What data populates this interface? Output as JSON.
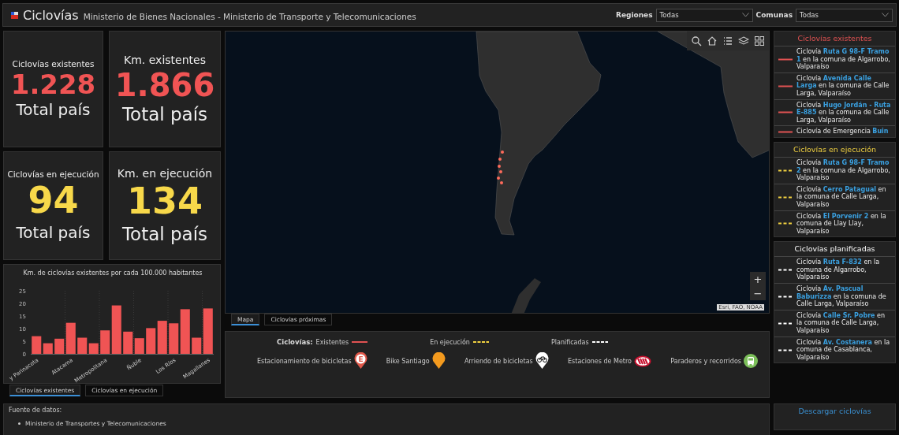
{
  "header": {
    "title": "Ciclovías",
    "subtitle": "Ministerio de Bienes Nacionales - Ministerio de Transporte y Telecomunicaciones",
    "filters": [
      {
        "label": "Regiones",
        "value": "Todas"
      },
      {
        "label": "Comunas",
        "value": "Todas"
      }
    ]
  },
  "stats": [
    {
      "label": "Ciclovías existentes",
      "value": "1.228",
      "caption": "Total país",
      "color": "#f05454"
    },
    {
      "label": "Km. existentes",
      "value": "1.866",
      "caption": "Total país",
      "color": "#f05454"
    },
    {
      "label": "Ciclovías en ejecución",
      "value": "94",
      "caption": "Total país",
      "color": "#f7d84a"
    },
    {
      "label": "Km. en ejecución",
      "value": "134",
      "caption": "Total país",
      "color": "#f7d84a"
    }
  ],
  "chart": {
    "chart_data": {
      "type": "bar",
      "title": "Km. de ciclovías existentes por cada 100.000 habitantes",
      "categories": [
        "y Parinacota",
        null,
        null,
        "Atacama",
        null,
        null,
        "Metropolitana",
        null,
        null,
        "Ñuble",
        null,
        null,
        "Los Ríos",
        null,
        null,
        "Magallanes"
      ],
      "values": [
        7,
        4.2,
        6,
        12.3,
        6.4,
        4.2,
        9.3,
        19.2,
        8.8,
        6.2,
        10.2,
        13.1,
        12.1,
        17.7,
        6.4,
        18
      ],
      "ylim": [
        0,
        25
      ],
      "yticks": [
        0,
        5,
        10,
        15,
        20,
        25
      ]
    }
  },
  "chart_tabs": [
    {
      "label": "Ciclovías existentes",
      "selected": true
    },
    {
      "label": "Ciclovías en ejecución",
      "selected": false
    }
  ],
  "map": {
    "zoom_buttons": [
      "+",
      "−"
    ],
    "attribution": "Esri, FAO, NOAA"
  },
  "map_tabs": [
    {
      "label": "Mapa",
      "selected": true
    },
    {
      "label": "Ciclovías próximas",
      "selected": false
    }
  ],
  "legend": {
    "heading": "Ciclovías:",
    "lines": [
      {
        "label": "Existentes",
        "kind": "solid",
        "color": "#e05252"
      },
      {
        "label": "En ejecución",
        "kind": "dashed",
        "color": "#f0d040"
      },
      {
        "label": "Planificadas",
        "kind": "dashed",
        "color": "#ffffff"
      }
    ],
    "symbols": [
      {
        "label": "Estacionamiento de bicicletas",
        "kind": "parking",
        "glyph": "E"
      },
      {
        "label": "Bike Santiago",
        "kind": "bike-share"
      },
      {
        "label": "Arriendo de bicicletas",
        "kind": "rental"
      },
      {
        "label": "Estaciones de Metro",
        "kind": "metro"
      },
      {
        "label": "Paraderos y recorridos",
        "kind": "bus"
      }
    ]
  },
  "lists": [
    {
      "title": "Ciclovías existentes",
      "color": "#e05252",
      "kind": "solid",
      "items": [
        "Ciclovía **Ruta G 98-F Tramo 1** en la comuna de Algarrobo, Valparaíso",
        "Ciclovía **Avenida Calle Larga** en la comuna de Calle Larga, Valparaíso",
        "Ciclovía **Hugo Jordán - Ruta E-885** en la comuna de Calle Larga, Valparaíso",
        "Ciclovía de Emergencia **Buin**"
      ]
    },
    {
      "title": "Ciclovías en ejecución",
      "color": "#f0d040",
      "kind": "dashed",
      "items": [
        "Ciclovía **Ruta G 98-F Tramo 2** en la comuna de Algarrobo, Valparaíso",
        "Ciclovía **Cerro Patagual** en la comuna de Calle Larga, Valparaíso",
        "Ciclovía **El Porvenir 2** en la comuna de Llay Llay, Valparaíso"
      ]
    },
    {
      "title": "Ciclovías planificadas",
      "color": "#ffffff",
      "kind": "dashed",
      "items": [
        "Ciclovía **Ruta F-832** en la comuna de Algarrobo, Valparaíso",
        "Ciclovía **Av. Pascual Baburizza** en la comuna de Calle Larga, Valparaíso",
        "Ciclovía **Calle Sr. Pobre** en la comuna de Calle Larga, Valparaíso",
        "Ciclovía **Av. Costanera** en la comuna de Casablanca, Valparaíso"
      ]
    }
  ],
  "source": {
    "heading": "Fuente de datos:",
    "items": [
      "Ministerio de Transportes y Telecomunicaciones"
    ]
  },
  "download": {
    "label": "Descargar ciclovías"
  }
}
